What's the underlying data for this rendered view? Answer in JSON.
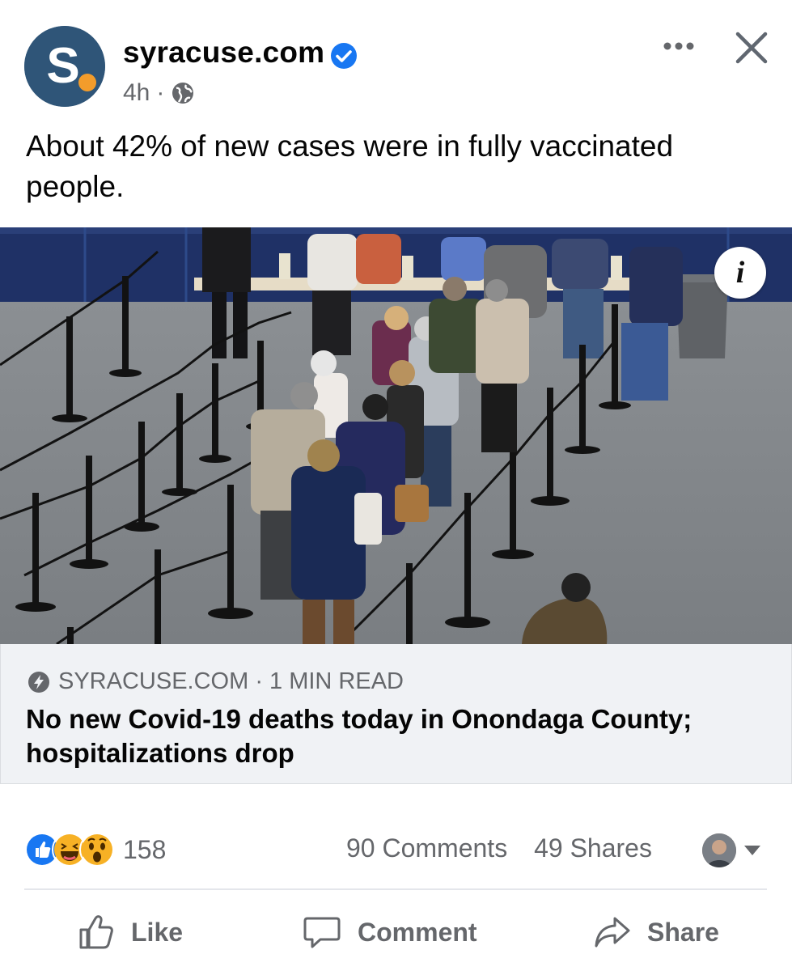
{
  "post": {
    "page_name": "syracuse.com",
    "avatar_letter": "S",
    "time": "4h",
    "separator": "·",
    "privacy_icon": "globe-icon",
    "text": "About 42% of new cases were in fully vaccinated people."
  },
  "link_preview": {
    "source": "SYRACUSE.COM · 1 MIN READ",
    "headline": "No new Covid-19 deaths today in Onondaga County; hospitalizations drop",
    "info_label": "i"
  },
  "engagement": {
    "reaction_icons": [
      "like-reaction-icon",
      "haha-reaction-icon",
      "wow-reaction-icon"
    ],
    "reaction_count": "158",
    "comments": "90 Comments",
    "shares": "49 Shares"
  },
  "actions": {
    "like": "Like",
    "comment": "Comment",
    "share": "Share"
  },
  "colors": {
    "verified_blue": "#1877f2",
    "brand_navy": "#2f5578",
    "brand_orange": "#f39c2b",
    "muted_text": "#65676b"
  }
}
